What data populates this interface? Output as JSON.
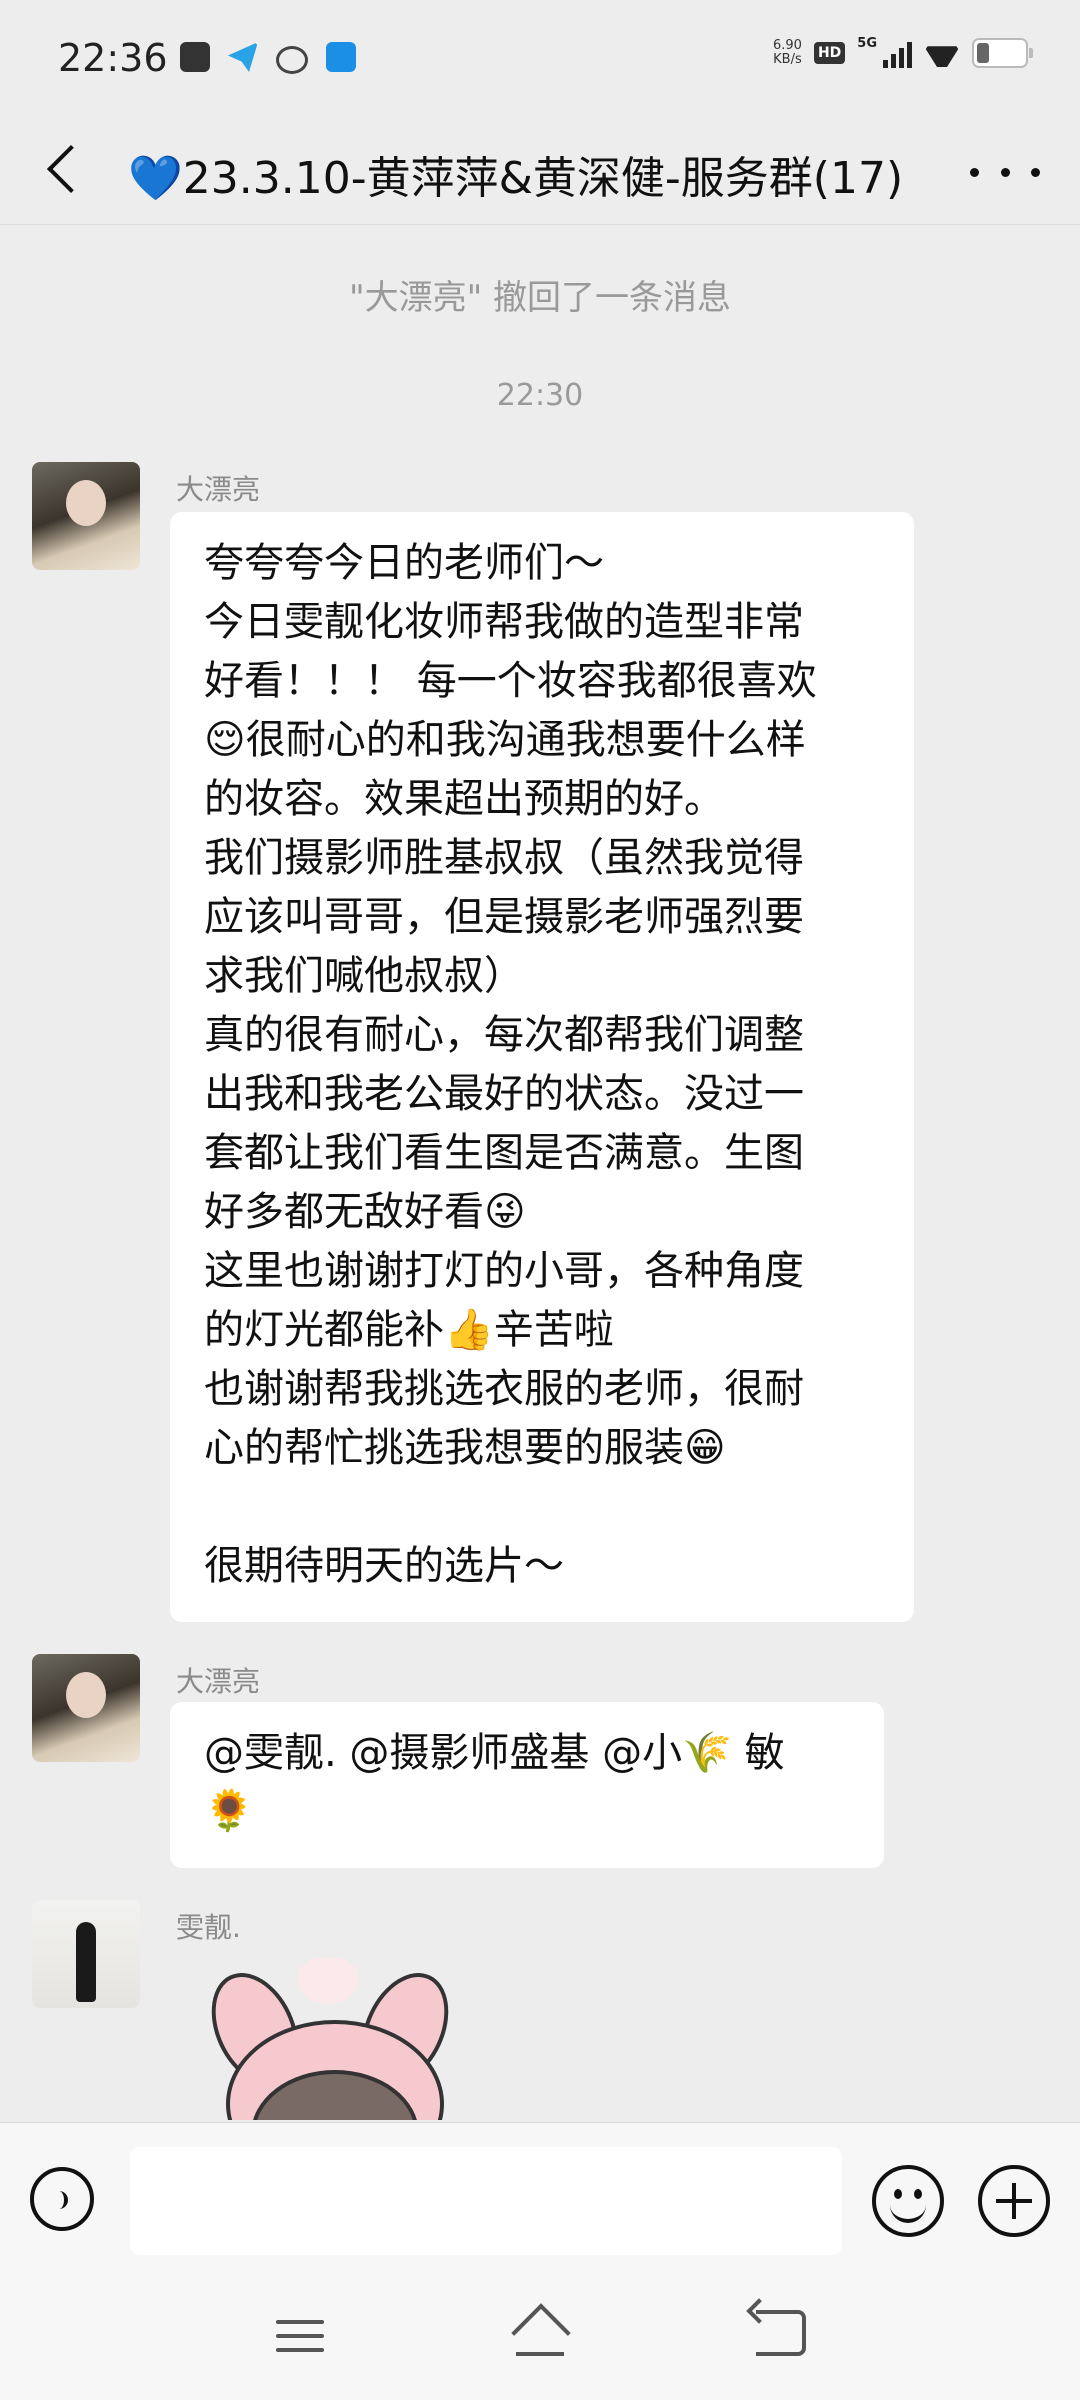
{
  "status_bar": {
    "time": "22:36",
    "net_speed_value": "6.90",
    "net_speed_unit": "KB/s",
    "hd_label": "HD",
    "network_label": "5G"
  },
  "header": {
    "title": "💙23.3.10-黄萍萍&黄深健-服务群(17)"
  },
  "system_note": "\"大漂亮\" 撤回了一条消息",
  "timestamp": "22:30",
  "messages": [
    {
      "sender": "大漂亮",
      "lines": [
        "夸夸夸今日的老师们～",
        "今日雯靓化妆师帮我做的造型非常",
        "好看！！！ 每一个妆容我都很喜欢",
        "😌很耐心的和我沟通我想要什么样",
        "的妆容。效果超出预期的好。",
        "我们摄影师胜基叔叔（虽然我觉得",
        "应该叫哥哥，但是摄影老师强烈要",
        "求我们喊他叔叔）",
        "真的很有耐心，每次都帮我们调整",
        "出我和我老公最好的状态。没过一",
        "套都让我们看生图是否满意。生图",
        "好多都无敌好看😜",
        "这里也谢谢打灯的小哥，各种角度",
        "的灯光都能补👍辛苦啦",
        "也谢谢帮我挑选衣服的老师，很耐",
        "心的帮忙挑选我想要的服装😁",
        "",
        "很期待明天的选片～"
      ]
    },
    {
      "sender": "大漂亮",
      "lines": [
        "@雯靓. @摄影师盛基  @小🌾 敏",
        "🌻"
      ]
    },
    {
      "sender": "雯靓."
    }
  ],
  "input": {
    "placeholder": ""
  }
}
